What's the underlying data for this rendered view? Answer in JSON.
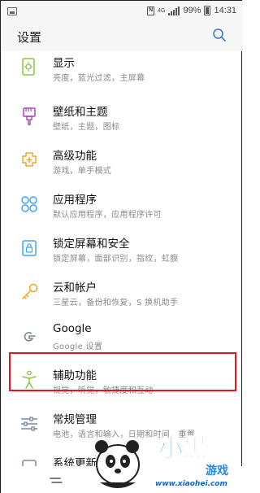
{
  "statusbar": {
    "network": "4G",
    "battery": "99%",
    "time": "14:31"
  },
  "header": {
    "title": "设置"
  },
  "items": [
    {
      "label": "显示",
      "sub": "亮度，蓝光过滤，主屏幕",
      "icon": "display-icon"
    },
    {
      "label": "壁纸和主题",
      "sub": "壁纸，主题，图标",
      "icon": "brush-icon"
    },
    {
      "label": "高级功能",
      "sub": "游戏，单手模式",
      "icon": "puzzle-plus-icon"
    },
    {
      "label": "应用程序",
      "sub": "默认应用程序，应用程序许可",
      "icon": "apps-grid-icon"
    },
    {
      "label": "锁定屏幕和安全",
      "sub": "锁定屏幕，面部识别，指纹，虹膜",
      "icon": "lock-icon"
    },
    {
      "label": "云和帐户",
      "sub": "三星云，备份和恢复，S 换机助手",
      "icon": "key-icon"
    },
    {
      "label": "Google",
      "sub": "Google 设置",
      "icon": "google-icon"
    },
    {
      "label": "辅助功能",
      "sub": "视觉，听觉，敏捷度和互动",
      "icon": "accessibility-icon"
    },
    {
      "label": "常规管理",
      "sub": "电池，语言和输入，日期和时间，重置",
      "icon": "sliders-icon"
    },
    {
      "label": "系统更新",
      "sub": "",
      "icon": "system-update-icon"
    }
  ],
  "colors": {
    "icon_green": "#8bc34a",
    "icon_purple": "#ab47bc",
    "icon_orange": "#f4a623",
    "icon_blue": "#42a5f5",
    "icon_gray": "#7a8a99",
    "highlight_border": "#e0161d"
  },
  "watermark": {
    "text_top": "小黑",
    "text_side": "游戏",
    "text_url": "www.xiaohei.com"
  }
}
